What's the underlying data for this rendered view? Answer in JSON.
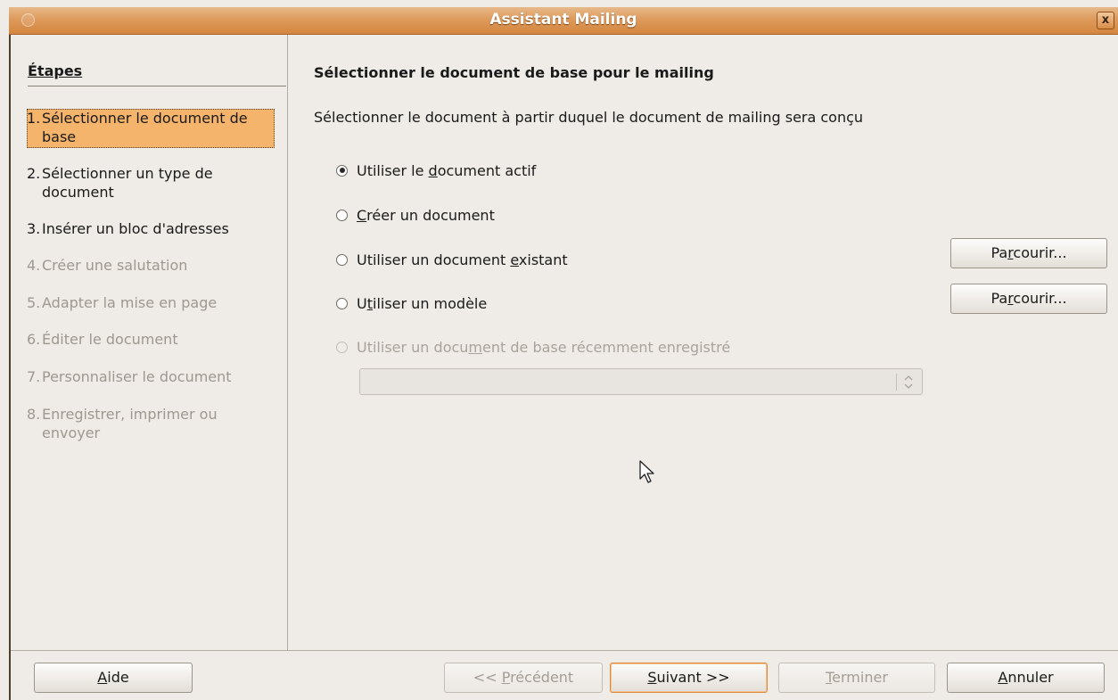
{
  "window": {
    "title": "Assistant Mailing",
    "close_label": "x"
  },
  "sidebar": {
    "title": "Étapes",
    "steps": [
      {
        "num": "1.",
        "label": "Sélectionner le document de base",
        "state": "active"
      },
      {
        "num": "2.",
        "label": "Sélectionner un type de document",
        "state": "enabled"
      },
      {
        "num": "3.",
        "label": "Insérer un bloc d'adresses",
        "state": "enabled"
      },
      {
        "num": "4.",
        "label": "Créer une salutation",
        "state": "disabled"
      },
      {
        "num": "5.",
        "label": "Adapter la mise en page",
        "state": "disabled"
      },
      {
        "num": "6.",
        "label": "Éditer le document",
        "state": "disabled"
      },
      {
        "num": "7.",
        "label": "Personnaliser le document",
        "state": "disabled"
      },
      {
        "num": "8.",
        "label": "Enregistrer, imprimer ou envoyer",
        "state": "disabled"
      }
    ]
  },
  "main": {
    "heading": "Sélectionner le document de base pour le mailing",
    "description": "Sélectionner le document à partir duquel le document de mailing sera conçu",
    "options": [
      {
        "pre": "Utiliser le ",
        "mnemonic": "d",
        "post": "ocument actif",
        "checked": true,
        "enabled": true
      },
      {
        "pre": "",
        "mnemonic": "C",
        "post": "réer un document",
        "checked": false,
        "enabled": true
      },
      {
        "pre": "Utiliser un document ",
        "mnemonic": "e",
        "post": "xistant",
        "checked": false,
        "enabled": true
      },
      {
        "pre": "U",
        "mnemonic": "t",
        "post": "iliser un modèle",
        "checked": false,
        "enabled": true
      },
      {
        "pre": "Utiliser un docu",
        "mnemonic": "m",
        "post": "ent de base récemment enregistré",
        "checked": false,
        "enabled": false
      }
    ],
    "browse_button": {
      "pre": "Pa",
      "mnemonic": "r",
      "post": "courir..."
    },
    "recent_select_value": ""
  },
  "footer": {
    "help": {
      "pre": "",
      "mnemonic": "A",
      "post": "ide"
    },
    "previous": {
      "pre": "<< ",
      "mnemonic": "P",
      "post": "récédent"
    },
    "next": {
      "pre": "",
      "mnemonic": "S",
      "post": "uivant >>"
    },
    "finish": {
      "pre": "",
      "mnemonic": "T",
      "post": "erminer"
    },
    "cancel": {
      "pre": "",
      "mnemonic": "A",
      "post": "nnuler"
    }
  }
}
